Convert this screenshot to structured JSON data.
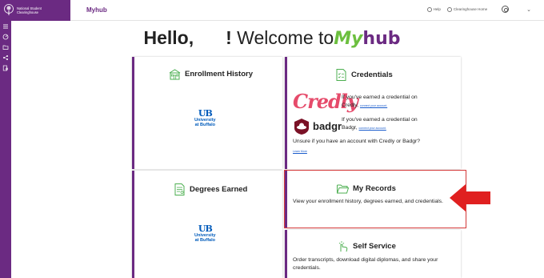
{
  "header": {
    "logo_line1": "National Student",
    "logo_line2": "Clearinghouse",
    "app_title": "Myhub",
    "help_label": "Help",
    "clearinghouse_link": "Clearinghouse Home"
  },
  "sidebar": {
    "items": [
      {
        "icon": "menu-icon"
      },
      {
        "icon": "dashboard-icon"
      },
      {
        "icon": "folder-icon"
      },
      {
        "icon": "share-icon"
      },
      {
        "icon": "document-search-icon"
      }
    ]
  },
  "greeting": {
    "hello": "Hello,",
    "exclaim": "!",
    "welcome": "Welcome to",
    "brand_my": "My",
    "brand_hub": "hub"
  },
  "cards": {
    "enrollment": {
      "title": "Enrollment History",
      "school_line1": "University",
      "school_line2": "at Buffalo"
    },
    "credentials": {
      "title": "Credentials",
      "credly_logo": "Credly",
      "credly_text_a": "If you've earned a credential on",
      "credly_text_b": "Credly,",
      "credly_link": "connect your account.",
      "badgr_logo": "badgr",
      "badgr_text_a": "If you've earned a credential on",
      "badgr_text_b": "Badgr,",
      "badgr_link": "connect your account.",
      "unsure_text": "Unsure if you have an account with Credly or Badgr?",
      "learn_more": "Learn More"
    },
    "degrees": {
      "title": "Degrees Earned",
      "school_line1": "University",
      "school_line2": "at Buffalo"
    },
    "my_records": {
      "title": "My Records",
      "description": "View your enrollment history, degrees earned, and credentials."
    },
    "self_service": {
      "title": "Self Service",
      "description": "Order transcripts, download digital diplomas, and share your credentials."
    }
  },
  "colors": {
    "brand_purple": "#6b2a82",
    "brand_green": "#6cbf3f",
    "highlight_red": "#d63b3b",
    "credly_pink": "#e64b6b",
    "ub_blue": "#005bbb"
  }
}
